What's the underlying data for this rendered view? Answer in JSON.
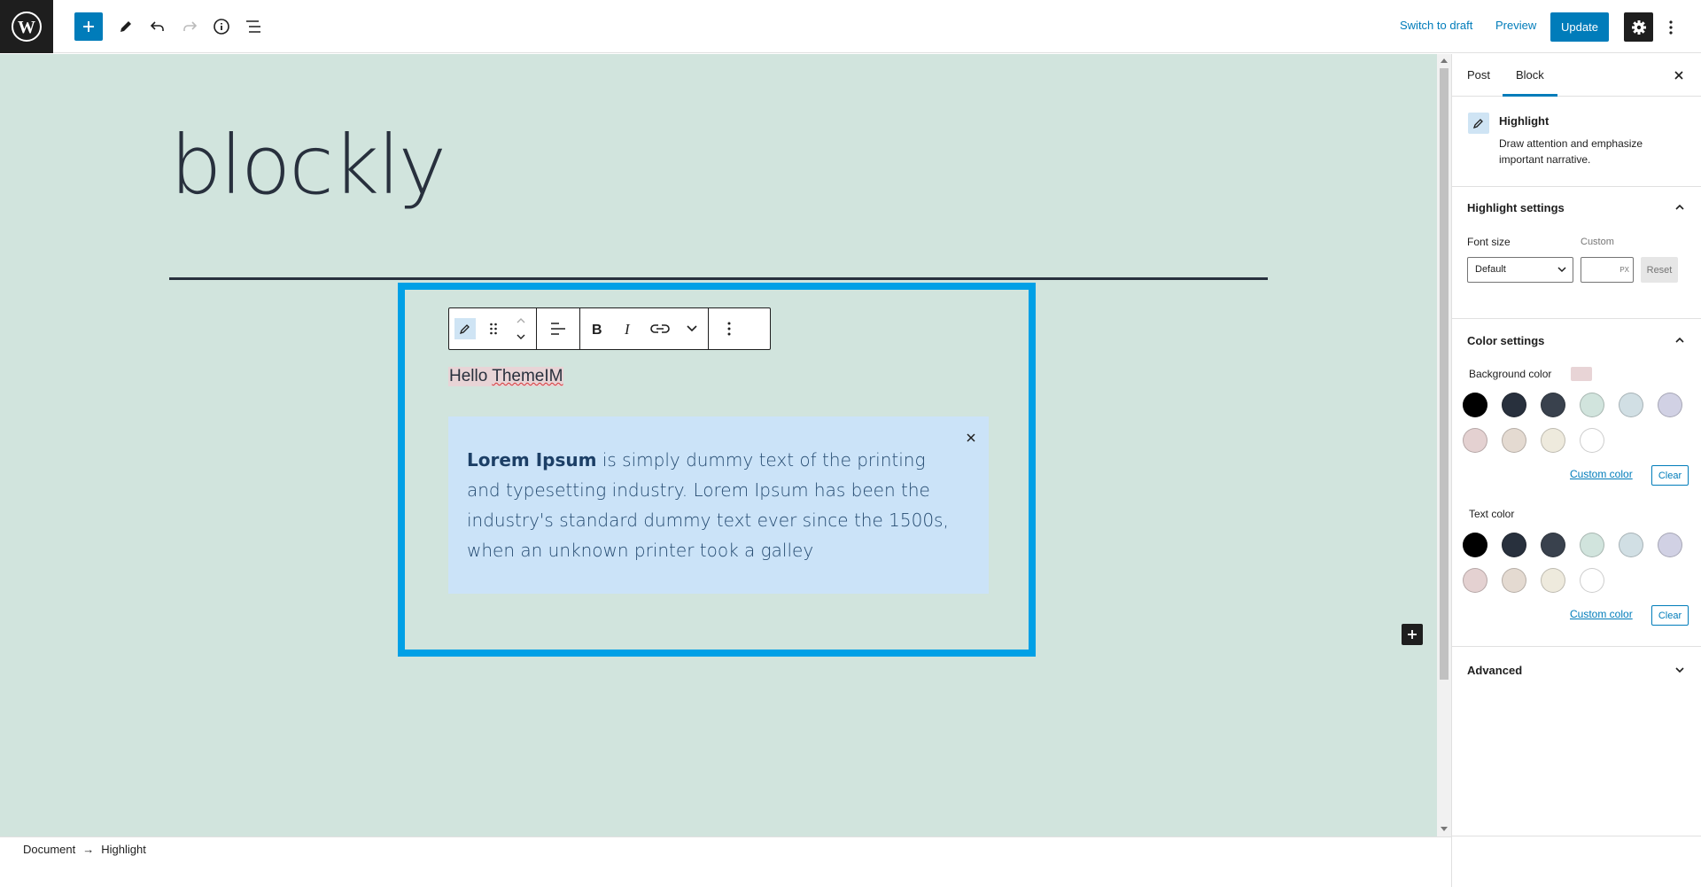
{
  "topbar": {
    "logo_icon": "wordpress-logo-icon",
    "add_block_icon": "plus-icon",
    "tools_icon": "pencil-icon",
    "undo_icon": "undo-icon",
    "redo_icon": "redo-icon",
    "details_icon": "info-icon",
    "list_view_icon": "list-view-icon",
    "switch_to_draft": "Switch to draft",
    "preview": "Preview",
    "update": "Update",
    "settings_icon": "gear-icon",
    "more_icon": "more-vertical-icon"
  },
  "canvas": {
    "post_title": "blockly",
    "background_color": "#d1e4dd",
    "block_outline_color": "#00a0e6",
    "highlight_text_before": "Hello ",
    "highlight_text_word": "ThemeIM",
    "notice": {
      "bold": "Lorem Ipsum",
      "text": " is simply dummy text of the printing and typesetting industry. Lorem Ipsum has been the industry's standard dummy text ever since the 1500s, when an unknown printer took a galley",
      "close_icon": "close-icon",
      "background": "#cbe3f8"
    },
    "toolbar_icons": [
      "highlight-pencil-icon",
      "drag-handle-icon",
      "move-up-down-icon",
      "align-left-icon",
      "bold-icon",
      "italic-icon",
      "link-icon",
      "chevron-down-icon",
      "more-options-icon"
    ]
  },
  "footer": {
    "breadcrumb": [
      "Document",
      "→",
      "Highlight"
    ]
  },
  "sidebar": {
    "tabs": [
      "Post",
      "Block"
    ],
    "active_tab": "Block",
    "block_card": {
      "title": "Highlight",
      "description": "Draw attention and emphasize important narrative."
    },
    "highlight_settings": {
      "title": "Highlight settings",
      "font_size_label": "Font size",
      "custom_label": "Custom",
      "font_size_value": "Default",
      "unit": "PX",
      "reset": "Reset"
    },
    "color_settings": {
      "title": "Color settings",
      "background_label": "Background color",
      "background_selected": "#e8d4d6",
      "text_label": "Text color",
      "custom_color": "Custom color",
      "clear": "Clear",
      "palette": [
        "#000000",
        "#28303d",
        "#39414d",
        "#d1e4dd",
        "#d1dfe4",
        "#d1d1e4",
        "#e4d1d1",
        "#e4dad1",
        "#eeeadd",
        "#ffffff"
      ]
    },
    "advanced": {
      "title": "Advanced"
    }
  }
}
